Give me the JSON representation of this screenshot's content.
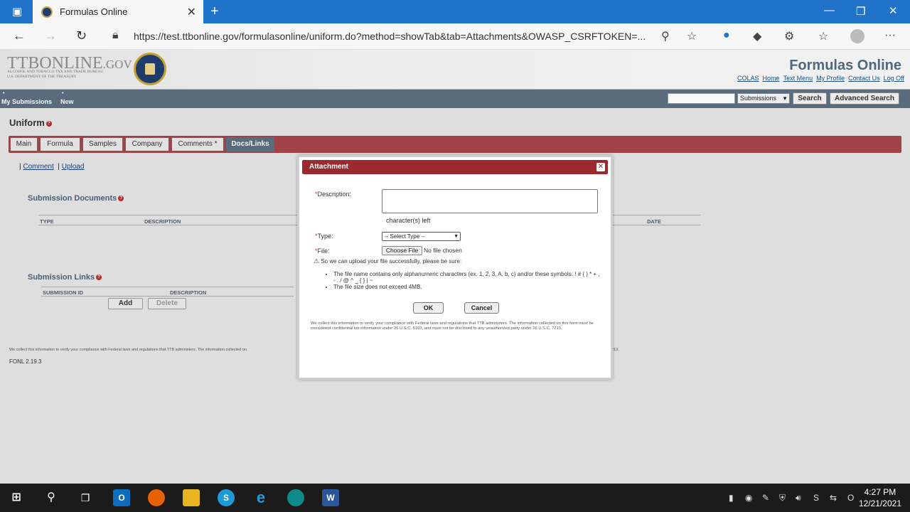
{
  "browser": {
    "tab_title": "Formulas Online",
    "url": "https://test.ttbonline.gov/formulasonline/uniform.do?method=showTab&tab=Attachments&OWASP_CSRFTOKEN=..."
  },
  "header": {
    "logo_text": "TTBONLINE",
    "logo_suffix": ".GOV",
    "logo_sub1": "Alcohol and Tobacco Tax and Trade Bureau",
    "logo_sub2": "U.S. Department of the Treasury",
    "app_title": "Formulas Online",
    "links": [
      "COLAS",
      "Home",
      "Text Menu",
      "My Profile",
      "Contact Us",
      "Log Off"
    ]
  },
  "nav": {
    "my_submissions": "My Submissions",
    "new": "New",
    "search_select": "Submissions",
    "search_btn": "Search",
    "advanced_btn": "Advanced Search"
  },
  "page": {
    "title": "Uniform",
    "tabs": [
      "Main",
      "Formula",
      "Samples",
      "Company",
      "Comments *",
      "Docs/Links"
    ],
    "sublinks": [
      "Comment",
      "Upload"
    ],
    "docs_title": "Submission Documents",
    "docs_cols": [
      "Type",
      "Description",
      "Date"
    ],
    "links_title": "Submission Links",
    "links_cols": [
      "Submission ID",
      "Description"
    ],
    "add_btn": "Add",
    "delete_btn": "Delete",
    "footer_notice": "We collect this information to verify your compliance with Federal laws and regulations that TTB administers. The information collected on",
    "footer_notice_end": "213.",
    "version": "FONL 2.19.3"
  },
  "modal": {
    "title": "Attachment",
    "desc_label": "Description:",
    "char_left": "character(s) left",
    "type_label": "Type:",
    "type_value": "-- Select Type --",
    "file_label": "File:",
    "choose_file": "Choose File",
    "no_file": "No file chosen",
    "warning": "So we can upload your file successfully, please be sure:",
    "rule1": "The file name contains only alphanumeric characters (ex. 1, 2, 3, A, b, c) and/or these symbols: ! # ( ) * + , - . / @ ^ _ { } | ~",
    "rule2": "The file size does not exceed 4MB.",
    "ok": "OK",
    "cancel": "Cancel",
    "notice": "We collect this information to verify your compliance with Federal laws and regulations that TTB administers. The information collected on this form must be considered confidential tax information under 26 U.S.C. 6103, and must not be disclosed to any unauthorized party under 26 U.S.C. 7213."
  },
  "taskbar": {
    "time": "4:27 PM",
    "date": "12/21/2021"
  }
}
